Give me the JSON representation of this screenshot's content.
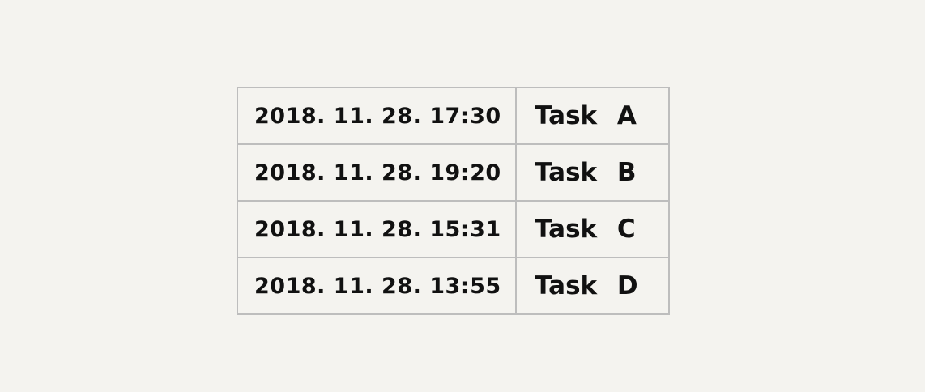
{
  "tasks": [
    {
      "time": "2018. 11. 28. 17:30",
      "name": "Task A"
    },
    {
      "time": "2018. 11. 28. 19:20",
      "name": "Task B"
    },
    {
      "time": "2018. 11. 28. 15:31",
      "name": "Task C"
    },
    {
      "time": "2018. 11. 28. 13:55",
      "name": "Task D"
    }
  ]
}
